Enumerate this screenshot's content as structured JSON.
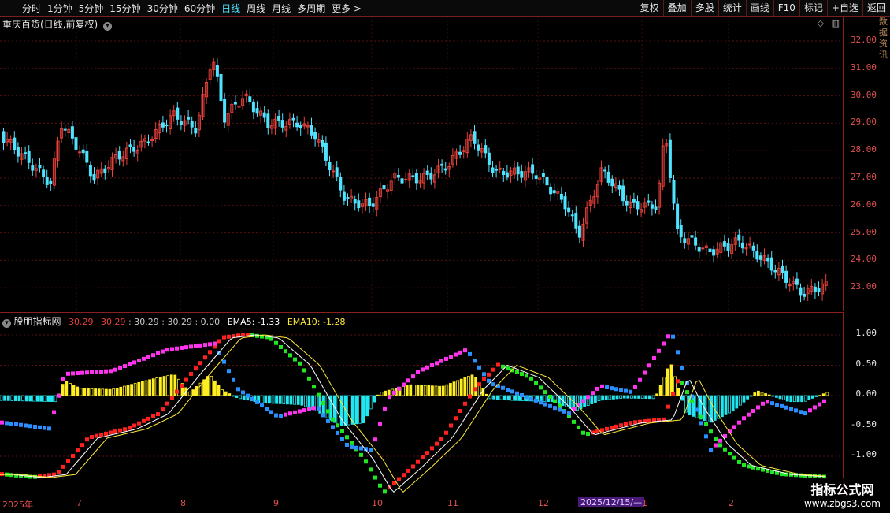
{
  "toolbar": {
    "tabs": [
      "分时",
      "1分钟",
      "5分钟",
      "15分钟",
      "30分钟",
      "60分钟",
      "日线",
      "周线",
      "月线",
      "多周期",
      "更多 >"
    ],
    "active_tab": "日线",
    "right_buttons": [
      "复权",
      "叠加",
      "多股",
      "统计",
      "画线",
      "F10",
      "标记",
      "+自选",
      "返回"
    ]
  },
  "main_chart": {
    "title": "重庆百货(日线,前复权)",
    "y_labels": [
      "32.00",
      "31.00",
      "30.00",
      "29.00",
      "28.00",
      "27.00",
      "26.00",
      "25.00",
      "24.00",
      "23.00"
    ],
    "up_color": "#e8403a",
    "down_color": "#4fe3ff"
  },
  "sub_chart": {
    "title": "股朋指标网",
    "values": [
      "30.29",
      "30.29",
      "30.29",
      "30.29",
      "0.00"
    ],
    "ema5_label": "EMA5: -1.33",
    "ema10_label": "EMA10: -1.28",
    "y_labels": [
      "1.00",
      "0.50",
      "0.00",
      "-0.50",
      "-1.00"
    ]
  },
  "x_axis": {
    "labels": [
      "2025年",
      "7",
      "8",
      "9",
      "10",
      "11",
      "12",
      "1",
      "2"
    ],
    "cursor_date": "2025/12/15/—"
  },
  "watermark": {
    "line1": "指标公式网",
    "line2": "www.zbgs3.com"
  },
  "side_text": "数据资讯"
}
